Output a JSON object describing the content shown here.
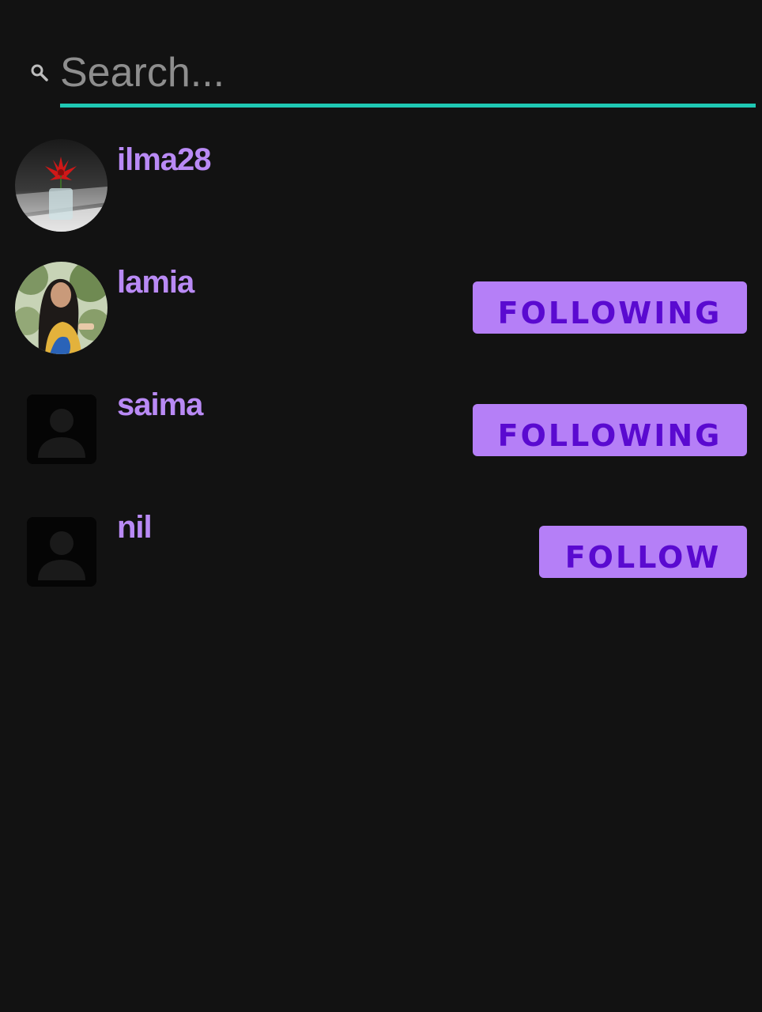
{
  "search": {
    "placeholder": "Search...",
    "icon": "search-icon",
    "underline_color": "#1fc8b4"
  },
  "users": [
    {
      "username": "ilma28",
      "avatar": "flower-photo",
      "button": null
    },
    {
      "username": "lamia",
      "avatar": "person-photo",
      "button": "FOLLOWING"
    },
    {
      "username": "saima",
      "avatar": "default-avatar-icon",
      "button": "FOLLOWING"
    },
    {
      "username": "nil",
      "avatar": "default-avatar-icon",
      "button": "FOLLOW"
    }
  ],
  "colors": {
    "background": "#121212",
    "username": "#b98af5",
    "button_bg": "#b57ff7",
    "button_text": "#5a0ad0"
  }
}
